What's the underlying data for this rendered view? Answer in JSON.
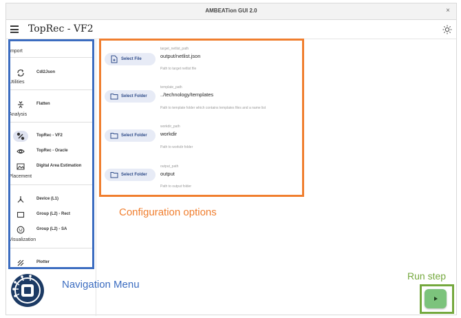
{
  "window": {
    "title": "AMBEATion GUI 2.0",
    "close_glyph": "×"
  },
  "header": {
    "app_title": "TopRec - VF2",
    "menu_icon": "hamburger-icon",
    "theme_icon": "sun-icon"
  },
  "sidebar": {
    "sections": {
      "import": "Import",
      "utilities": "Utilities",
      "analysis": "Analysis",
      "placement": "Placement",
      "visualization": "Visualization"
    },
    "items": [
      {
        "label": "Cdl2Json",
        "icon": "convert-icon",
        "active": false
      },
      {
        "label": "Flatten",
        "icon": "flatten-icon",
        "active": false
      },
      {
        "label": "TopRec - VF2",
        "icon": "toprec-icon",
        "active": true
      },
      {
        "label": "TopRec - Oracle",
        "icon": "eye-icon",
        "active": false
      },
      {
        "label": "Digital Area Estimation",
        "icon": "landscape-icon",
        "active": false
      },
      {
        "label": "Device (L1)",
        "icon": "device-icon",
        "active": false
      },
      {
        "label": "Group (L2) - Rect",
        "icon": "rectangle-icon",
        "active": false
      },
      {
        "label": "Group (L2) - SA",
        "icon": "smiley-icon",
        "active": false
      },
      {
        "label": "Plotter",
        "icon": "plotter-icon",
        "active": false
      }
    ]
  },
  "options": [
    {
      "button": "Select File",
      "name": "target_netlist_path",
      "value": "output/netlist.json",
      "help": "Path to target netlist file"
    },
    {
      "button": "Select Folder",
      "name": "template_path",
      "value": "../technology/templates",
      "help": "Path to template folder which contains templates files and a name list"
    },
    {
      "button": "Select Folder",
      "name": "workdir_path",
      "value": "workdir",
      "help": "Path to workdir folder"
    },
    {
      "button": "Select Folder",
      "name": "output_path",
      "value": "output",
      "help": "Path to output folder"
    }
  ],
  "annotations": {
    "config": "Configuration options",
    "navigation": "Navigation Menu",
    "run": "Run step"
  },
  "colors": {
    "config_box": "#f07e2e",
    "nav_box": "#3b6cc0",
    "run_box": "#74a83d",
    "run_button": "#7cc37c",
    "button_bg": "#e7ebf6"
  }
}
